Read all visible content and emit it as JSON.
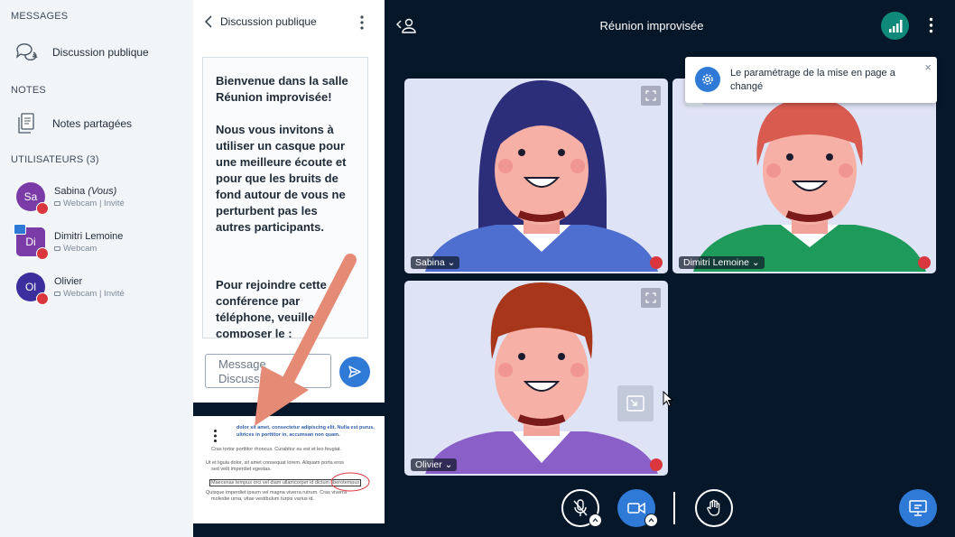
{
  "sidebar": {
    "messages_heading": "MESSAGES",
    "public_chat_label": "Discussion publique",
    "notes_heading": "NOTES",
    "shared_notes_label": "Notes partagées",
    "users_heading": "UTILISATEURS (3)",
    "users": [
      {
        "initials": "Sa",
        "name": "Sabina",
        "you_tag": "(Vous)",
        "role": "Webcam | Invité",
        "color": "#7a3ba7"
      },
      {
        "initials": "Di",
        "name": "Dimitri Lemoine",
        "you_tag": "",
        "role": "Webcam",
        "color": "#7a3ba7"
      },
      {
        "initials": "Ol",
        "name": "Olivier",
        "you_tag": "",
        "role": "Webcam | Invité",
        "color": "#3a2f9c"
      }
    ]
  },
  "chat": {
    "title": "Discussion publique",
    "welcome_line1": "Bienvenue dans la salle",
    "welcome_room": "Réunion improvisée!",
    "welcome_para2": "Nous vous invitons à utiliser un casque pour une meilleure écoute et pour que les bruits de fond autour de vous ne perturbent pas les autres participants.",
    "welcome_para3": "Pour rejoindre cette conférence par téléphone, veuillez composer le :",
    "input_placeholder": "Message Discussion publique"
  },
  "presentation": {
    "line1": "dolor sit amet, consectetur adipiscing elit. Nulla est purus,",
    "line2": "ultrices in porttitor in, accumsan non quam.",
    "line3": "Cras tortor porttitor rhoncus. Curabitur eu est et leo feugiat.",
    "line4": "Ut et ligula dolor, sit amet consequat lorem. Aliquam porta eros",
    "line5": "sed velit imperdiet egestas.",
    "line6": "Maecenas tempus orci vel diam ullamcorper id dictum liberotempus",
    "line7": "Quisque imperdiet ipsum vel magna viverra rutrum. Cras viverra",
    "line8": "molestie urna, vitae vestibulum turpis varius id."
  },
  "meeting": {
    "title": "Réunion improvisée"
  },
  "toast": {
    "message": "Le paramétrage de la mise en page a changé",
    "close": "×"
  },
  "tiles": [
    {
      "name": "Sabina",
      "hair": "#2c2e7a",
      "shirt": "#4f6fd0"
    },
    {
      "name": "Dimitri Lemoine",
      "hair": "#d95a4e",
      "shirt": "#1e9a5a"
    },
    {
      "name": "Olivier",
      "hair": "#a8361a",
      "shirt": "#8a5fc8"
    }
  ],
  "colors": {
    "accent": "#2f7ad6",
    "background": "#06172a",
    "mic_muted": "#d9363e",
    "connection": "#0f8a7a"
  }
}
